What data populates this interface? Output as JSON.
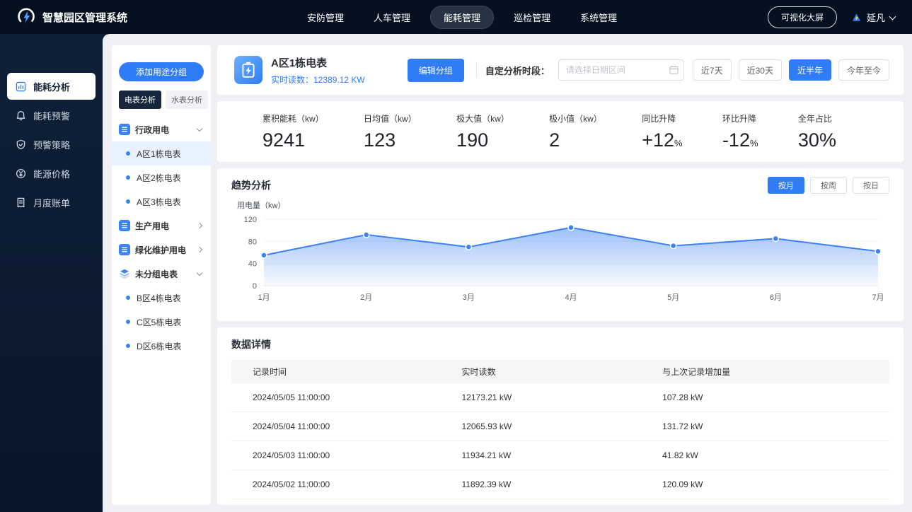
{
  "app": {
    "title": "智慧园区管理系统",
    "nav": [
      {
        "label": "安防管理",
        "active": false
      },
      {
        "label": "人车管理",
        "active": false
      },
      {
        "label": "能耗管理",
        "active": true
      },
      {
        "label": "巡检管理",
        "active": false
      },
      {
        "label": "系统管理",
        "active": false
      }
    ],
    "big_screen_button": "可视化大屏",
    "user": {
      "name": "延凡"
    }
  },
  "sidebar": {
    "items": [
      {
        "label": "能耗分析",
        "icon": "analysis-icon",
        "active": true
      },
      {
        "label": "能耗预警",
        "icon": "alert-icon",
        "active": false
      },
      {
        "label": "预警策略",
        "icon": "strategy-icon",
        "active": false
      },
      {
        "label": "能源价格",
        "icon": "price-icon",
        "active": false
      },
      {
        "label": "月度账单",
        "icon": "bill-icon",
        "active": false
      }
    ]
  },
  "group_panel": {
    "add_button": "添加用途分组",
    "tabs": [
      {
        "label": "电表分析",
        "active": true
      },
      {
        "label": "水表分析",
        "active": false
      }
    ],
    "tree": [
      {
        "label": "行政用电",
        "icon": "group-icon",
        "expanded": true,
        "children": [
          {
            "label": "A区1栋电表",
            "selected": true
          },
          {
            "label": "A区2栋电表",
            "selected": false
          },
          {
            "label": "A区3栋电表",
            "selected": false
          }
        ]
      },
      {
        "label": "生产用电",
        "icon": "group-icon",
        "expanded": false,
        "children": []
      },
      {
        "label": "绿化维护用电",
        "icon": "group-icon",
        "expanded": false,
        "children": []
      },
      {
        "label": "未分组电表",
        "icon": "layers-icon",
        "expanded": true,
        "children": [
          {
            "label": "B区4栋电表",
            "selected": false
          },
          {
            "label": "C区5栋电表",
            "selected": false
          },
          {
            "label": "D区6栋电表",
            "selected": false
          }
        ]
      }
    ]
  },
  "detail": {
    "meter_name": "A区1栋电表",
    "realtime_reading": "实时读数：12389.12 KW",
    "edit_group_button": "编辑分组",
    "period_label": "自定分析时段：",
    "date_placeholder": "请选择日期区间",
    "period_buttons": [
      {
        "label": "近7天",
        "active": false
      },
      {
        "label": "近30天",
        "active": false
      },
      {
        "label": "近半年",
        "active": true
      },
      {
        "label": "今年至今",
        "active": false
      }
    ]
  },
  "stats": [
    {
      "label": "累积能耗（kw）",
      "value": "9241",
      "suffix": ""
    },
    {
      "label": "日均值（kw）",
      "value": "123",
      "suffix": ""
    },
    {
      "label": "极大值（kw）",
      "value": "190",
      "suffix": ""
    },
    {
      "label": "极小值（kw）",
      "value": "2",
      "suffix": ""
    },
    {
      "label": "同比升降",
      "value": "+12",
      "suffix": "%"
    },
    {
      "label": "环比升降",
      "value": "-12",
      "suffix": "%"
    },
    {
      "label": "全年占比",
      "value": "30%",
      "suffix": ""
    }
  ],
  "chart_data": {
    "type": "area",
    "title": "趋势分析",
    "ylabel": "用电量（kw）",
    "x": [
      "1月",
      "2月",
      "3月",
      "4月",
      "5月",
      "6月",
      "7月"
    ],
    "series": [
      {
        "name": "用电量",
        "values": [
          55,
          92,
          70,
          105,
          72,
          85,
          62
        ]
      }
    ],
    "yticks": [
      0,
      40,
      80,
      120
    ],
    "ylim": [
      0,
      120
    ],
    "grid": true,
    "legend": "none",
    "line_color": "#3b82f6",
    "mode_buttons": [
      {
        "label": "按月",
        "active": true
      },
      {
        "label": "按周",
        "active": false
      },
      {
        "label": "按日",
        "active": false
      }
    ]
  },
  "table": {
    "title": "数据详情",
    "headers": [
      "记录时间",
      "实时读数",
      "与上次记录增加量"
    ],
    "rows": [
      [
        "2024/05/05 11:00:00",
        "12173.21 kW",
        "107.28 kW"
      ],
      [
        "2024/05/04 11:00:00",
        "12065.93 kW",
        "131.72 kW"
      ],
      [
        "2024/05/03 11:00:00",
        "11934.21 kW",
        "41.82 kW"
      ],
      [
        "2024/05/02 11:00:00",
        "11892.39 kW",
        "120.09 kW"
      ]
    ]
  },
  "colors": {
    "accent": "#2f7cf6",
    "topbar_bg": "#051020",
    "sidebar_bg": "#0e2038",
    "content_bg": "#eef0f4",
    "selected_row_bg": "#e8f1fe"
  }
}
